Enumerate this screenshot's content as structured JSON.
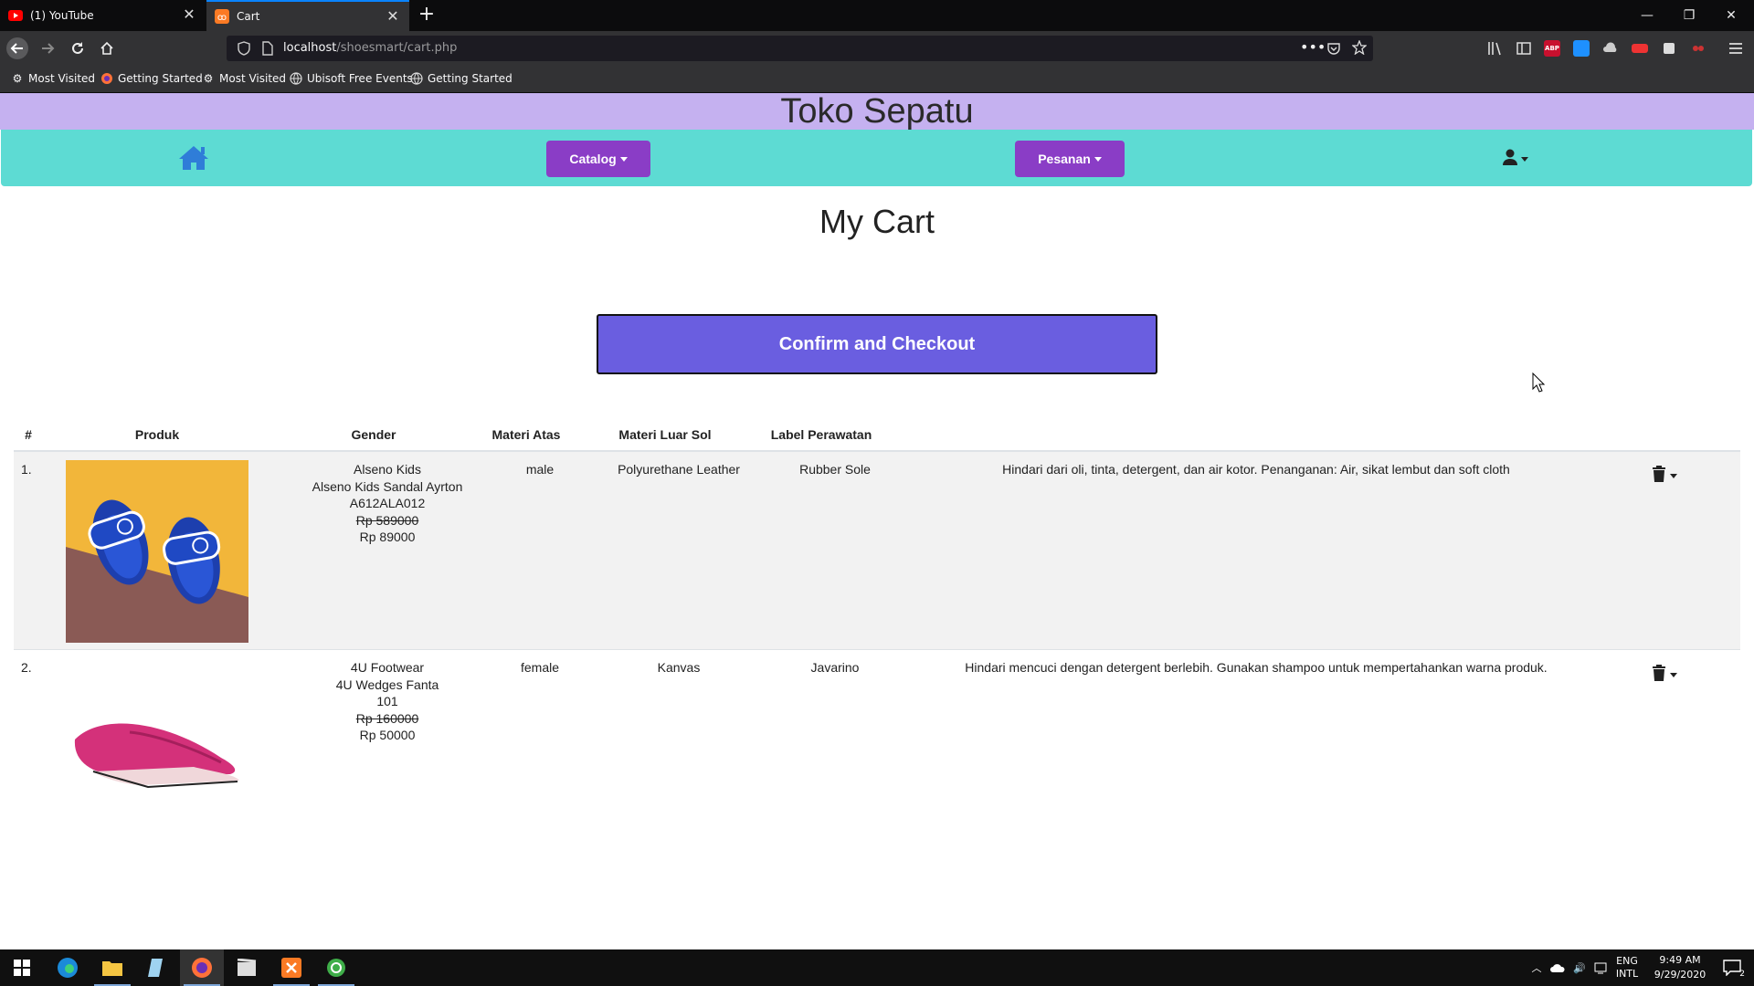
{
  "browser": {
    "tabs": [
      {
        "title": "(1) YouTube"
      },
      {
        "title": "Cart"
      }
    ],
    "url_host": "localhost",
    "url_path": "/shoesmart/cart.php",
    "bookmarks": [
      "Most Visited",
      "Getting Started",
      "Most Visited",
      "Ubisoft Free Events",
      "Getting Started"
    ]
  },
  "site": {
    "title": "Toko Sepatu",
    "menu": {
      "catalog_label": "Catalog",
      "pesanan_label": "Pesanan"
    }
  },
  "page": {
    "title": "My Cart",
    "checkout_label": "Confirm and Checkout"
  },
  "table": {
    "headers": [
      "#",
      "Produk",
      "Gender",
      "Materi Atas",
      "Materi Luar Sol",
      "Label Perawatan"
    ],
    "rows": [
      {
        "index": "1.",
        "brand": "Alseno Kids",
        "name": "Alseno Kids Sandal Ayrton",
        "code": "A612ALA012",
        "old_price": "Rp 589000",
        "price": "Rp 89000",
        "gender": "male",
        "materi_atas": "Polyurethane Leather",
        "materi_luar_sol": "Rubber Sole",
        "label_perawatan": "Hindari dari oli, tinta, detergent, dan air kotor. Penanganan: Air, sikat lembut dan soft cloth"
      },
      {
        "index": "2.",
        "brand": "4U Footwear",
        "name": "4U Wedges Fanta",
        "code": "101",
        "old_price": "Rp 160000",
        "price": "Rp 50000",
        "gender": "female",
        "materi_atas": "Kanvas",
        "materi_luar_sol": "Javarino",
        "label_perawatan": "Hindari mencuci dengan detergent berlebih. Gunakan shampoo untuk mempertahankan warna produk."
      }
    ]
  },
  "taskbar": {
    "lang": "ENG",
    "layout": "INTL",
    "time": "9:49 AM",
    "date": "9/29/2020",
    "notif_count": "2"
  },
  "colors": {
    "header_bg": "#c5b1f0",
    "menubar_bg": "#5ddbd3",
    "dropdown_bg": "#8a3dc6",
    "checkout_bg": "#6a5ee0"
  }
}
